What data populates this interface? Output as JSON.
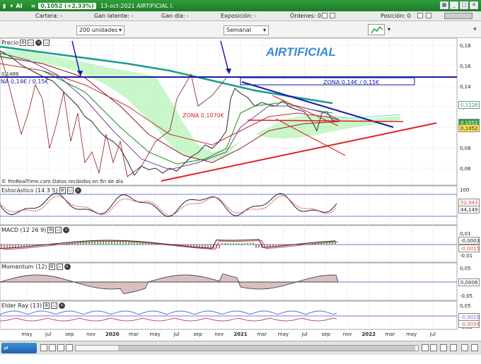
{
  "titlebar": {
    "ticker": "AI",
    "change": "0,1052 (+2,33%)",
    "date_name": "13-oct-2021 AIRTIFICIAL I."
  },
  "infobar": {
    "cartera": "Cartera: -",
    "gan_latente": "Gan latente: -",
    "gan_dia": "Gan día: -",
    "exposicion": "Exposición: -",
    "ordenes": "Órdenes: 0",
    "posicion": "Posición: 0"
  },
  "toolbar": {
    "units": "200 unidades",
    "period": "Semanal"
  },
  "chart": {
    "watermark": "AIRTIFICIAL",
    "panel_title": "Precio",
    "zona_top": "ZONA 0,14€ / 0,15€",
    "zona_left": "NA 0,14€ / 0,15€",
    "zona_mid": "ZONA 0,1070€",
    "level_label": "0,1488",
    "credit": "© ProRealTime.com  Datos recibidos en fin de día",
    "price_ticks": [
      "0,18",
      "0,16",
      "0,14",
      "0,12",
      "0,10",
      "0,08",
      "0,06"
    ],
    "price_tags": {
      "t1": "0,1226",
      "t2": "0,1052",
      "t3": "0,1052"
    },
    "stoch_title": "Estocástico (14 3 5)",
    "stoch_ticks": [
      "100"
    ],
    "stoch_tags": [
      "52,943",
      "44,149"
    ],
    "macd_title": "MACD (12 26 9)",
    "macd_ticks": [
      "0,01",
      "0",
      "-0,01"
    ],
    "macd_tags": [
      "-0,0003",
      "-0,0015"
    ],
    "mom_title": "Momentum (12)",
    "mom_ticks": [
      "0,05",
      "0",
      "-0,05"
    ],
    "mom_tags": [
      "0,0006"
    ],
    "elder_title": "Elder Ray (13)",
    "elder_ticks": [
      "0,05",
      "0",
      "-0,05"
    ],
    "elder_tags": [
      "-0,0019",
      "-0,0059"
    ],
    "x_labels": [
      "may",
      "jul",
      "sep",
      "nov",
      "2020",
      "mar",
      "may",
      "jul",
      "sep",
      "nov",
      "2021",
      "mar",
      "may",
      "jul",
      "sep",
      "nov",
      "2022",
      "mar",
      "may",
      "jul"
    ]
  },
  "bottom": {
    "compare": "Comparte"
  },
  "colors": {
    "green": "#2f9e3a",
    "blue": "#1a1aa8",
    "red": "#e02020",
    "cloud": "#9ff09f"
  }
}
